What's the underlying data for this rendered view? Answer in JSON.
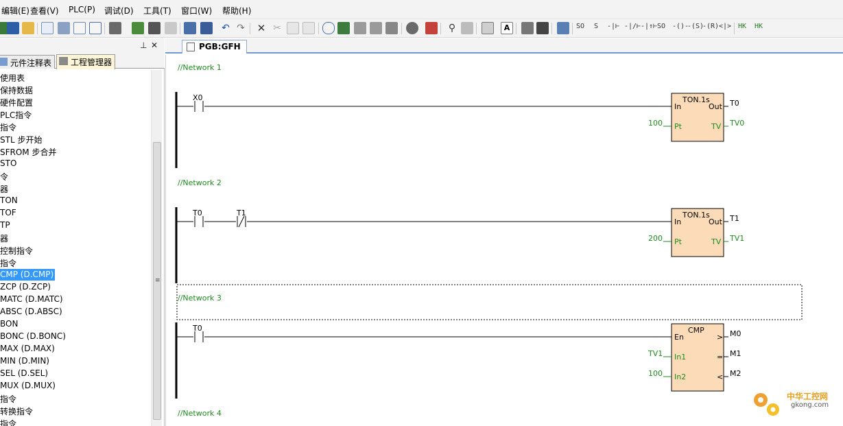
{
  "menu": [
    {
      "label": "编辑(E)"
    },
    {
      "label": "查看(V)"
    },
    {
      "label": "PLC(P)"
    },
    {
      "label": "调试(D)"
    },
    {
      "label": "工具(T)"
    },
    {
      "label": "窗口(W)"
    },
    {
      "label": "帮助(H)"
    }
  ],
  "toolbar": {
    "glyphs": [
      "SO",
      "S",
      "-|⊢",
      "-|/⊢",
      "-|↑⊢",
      "SO",
      "-()-",
      "-(S)",
      "-(R)",
      "<|>",
      "HK",
      "HK"
    ]
  },
  "left_panel": {
    "tabs": [
      {
        "label": "元件注释表"
      },
      {
        "label": "工程管理器"
      }
    ],
    "tree_items": [
      {
        "label": "使用表"
      },
      {
        "label": "保持数据"
      },
      {
        "label": "硬件配置"
      },
      {
        "label": "PLC指令"
      },
      {
        "label": "指令"
      },
      {
        "label": "STL 步开始"
      },
      {
        "label": "SFROM 步合并"
      },
      {
        "label": "STO"
      },
      {
        "label": "令"
      },
      {
        "label": "器"
      },
      {
        "label": "TON"
      },
      {
        "label": "TOF"
      },
      {
        "label": "TP"
      },
      {
        "label": "器"
      },
      {
        "label": "控制指令"
      },
      {
        "label": "指令"
      },
      {
        "label": "CMP (D.CMP)"
      },
      {
        "label": "ZCP (D.ZCP)"
      },
      {
        "label": "MATC (D.MATC)"
      },
      {
        "label": "ABSC (D.ABSC)"
      },
      {
        "label": "BON"
      },
      {
        "label": "BONC (D.BONC)"
      },
      {
        "label": "MAX (D.MAX)"
      },
      {
        "label": "MIN (D.MIN)"
      },
      {
        "label": "SEL (D.SEL)"
      },
      {
        "label": "MUX (D.MUX)"
      },
      {
        "label": "指令"
      },
      {
        "label": "转换指令"
      },
      {
        "label": "指令"
      }
    ],
    "selected_index": 16
  },
  "document": {
    "tab_label": "PGB:GFH",
    "networks": [
      {
        "label": "//Network 1",
        "contacts": [
          {
            "label": "X0",
            "type": "NO"
          }
        ],
        "block": {
          "title": "TON.1s",
          "in_pins": [
            {
              "name": "In",
              "input": ""
            },
            {
              "name": "Pt",
              "input": "100"
            }
          ],
          "out_pins": [
            {
              "name": "Out",
              "output": "T0"
            },
            {
              "name": "TV",
              "output": "TV0"
            }
          ]
        }
      },
      {
        "label": "//Network 2",
        "contacts": [
          {
            "label": "T0",
            "type": "NO"
          },
          {
            "label": "T1",
            "type": "NC"
          }
        ],
        "block": {
          "title": "TON.1s",
          "in_pins": [
            {
              "name": "In",
              "input": ""
            },
            {
              "name": "Pt",
              "input": "200"
            }
          ],
          "out_pins": [
            {
              "name": "Out",
              "output": "T1"
            },
            {
              "name": "TV",
              "output": "TV1"
            }
          ]
        }
      },
      {
        "label": "//Network 3",
        "contacts": [
          {
            "label": "T0",
            "type": "NO"
          }
        ],
        "block": {
          "title": "CMP",
          "in_pins": [
            {
              "name": "En",
              "input": ""
            },
            {
              "name": "In1",
              "input": "TV1"
            },
            {
              "name": "In2",
              "input": "100"
            }
          ],
          "out_pins": [
            {
              "name": ">",
              "output": "M0"
            },
            {
              "name": "=",
              "output": "M1"
            },
            {
              "name": "<",
              "output": "M2"
            }
          ]
        }
      },
      {
        "label": "//Network 4"
      }
    ]
  },
  "watermark": {
    "text_cn": "中华工控网",
    "text_en": "gkong.com"
  },
  "colors": {
    "block_fill": "#fcdcb8",
    "network_label": "#1e8a1e",
    "selection": "#3399ff"
  }
}
